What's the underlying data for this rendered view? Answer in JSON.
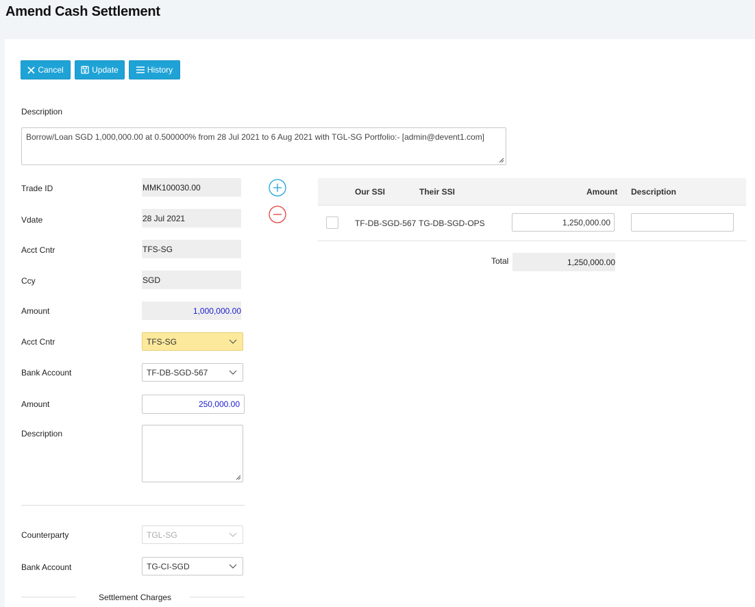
{
  "page": {
    "title": "Amend Cash Settlement"
  },
  "toolbar": {
    "cancel_label": "Cancel",
    "update_label": "Update",
    "history_label": "History"
  },
  "description": {
    "label": "Description",
    "value": "Borrow/Loan SGD 1,000,000.00 at 0.500000% from 28 Jul 2021 to 6 Aug 2021 with TGL-SG  Portfolio:- [admin@devent1.com]"
  },
  "trade": {
    "trade_id_label": "Trade ID",
    "trade_id": "MMK100030.00",
    "vdate_label": "Vdate",
    "vdate": "28 Jul 2021",
    "acct_cntr_label": "Acct Cntr",
    "acct_cntr": "TFS-SG",
    "ccy_label": "Ccy",
    "ccy": "SGD",
    "amount_label": "Amount",
    "amount": "1,000,000.00"
  },
  "settlement": {
    "acct_cntr_label": "Acct Cntr",
    "acct_cntr": "TFS-SG",
    "bank_account_label": "Bank Account",
    "bank_account": "TF-DB-SGD-567",
    "amount_label": "Amount",
    "amount": "250,000.00",
    "description_label": "Description",
    "description": ""
  },
  "counterparty": {
    "counterparty_label": "Counterparty",
    "counterparty": "TGL-SG",
    "bank_account_label": "Bank Account",
    "bank_account": "TG-CI-SGD",
    "charges_label": "Settlement Charges"
  },
  "ssi_table": {
    "headers": {
      "our_ssi": "Our SSI",
      "their_ssi": "Their SSI",
      "amount": "Amount",
      "description": "Description"
    },
    "rows": [
      {
        "our_ssi": "TF-DB-SGD-567",
        "their_ssi": "TG-DB-SGD-OPS",
        "amount": "1,250,000.00",
        "description": ""
      }
    ],
    "total_label": "Total",
    "total": "1,250,000.00"
  },
  "colors": {
    "primary": "#1fa3d6",
    "add": "#1fa3d6",
    "remove": "#e0413a",
    "highlight": "#fde99c",
    "amount_text": "#1a1acc"
  },
  "icons": {
    "cancel": "close-icon",
    "update": "save-icon",
    "history": "menu-icon",
    "add": "plus-circle-icon",
    "remove": "minus-circle-icon",
    "dropdown": "chevron-down-icon"
  }
}
